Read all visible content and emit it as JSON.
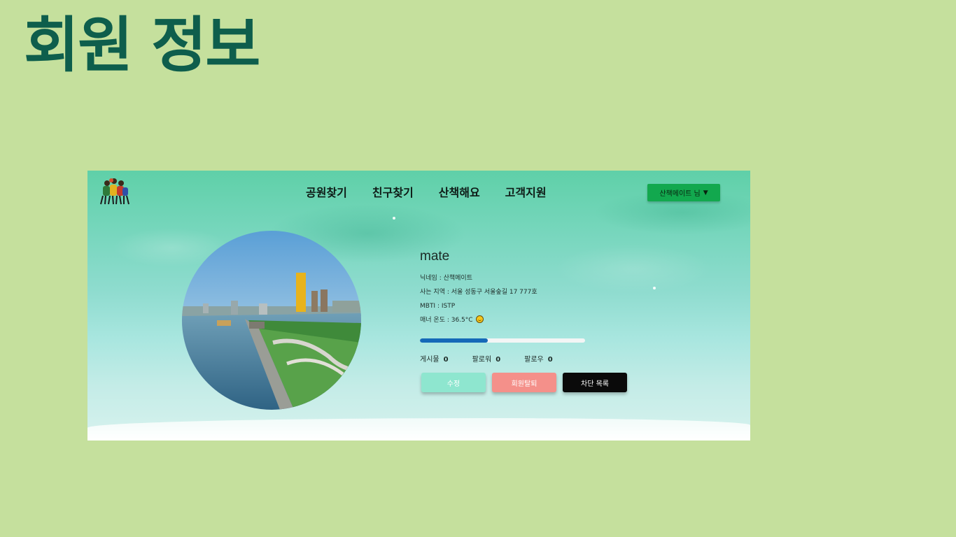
{
  "slide": {
    "title": "회원 정보"
  },
  "nav": {
    "menu": [
      "공원찾기",
      "친구찾기",
      "산책해요",
      "고객지원"
    ],
    "user_menu_label": "산책메이트 님"
  },
  "profile": {
    "username": "mate",
    "nickname_line": "닉네임 : 산책메이트",
    "region_line": "사는 지역 : 서울 성동구 서울숲길 17 777호",
    "mbti_line": "MBTI : ISTP",
    "manner_line": "매너 온도 : 36.5°C",
    "manner_progress": 0.41
  },
  "stats": [
    {
      "label": "게시물",
      "value": "0"
    },
    {
      "label": "팔로워",
      "value": "0"
    },
    {
      "label": "팔로우",
      "value": "0"
    }
  ],
  "buttons": {
    "edit": "수정",
    "withdraw": "회원탈퇴",
    "block_list": "차단 목록"
  },
  "colors": {
    "slide_bg": "#c5e09d",
    "title": "#0e5e4c",
    "user_menu_bg": "#12a84e",
    "edit_button": "#8ee6cf",
    "withdraw_button": "#f4908a",
    "block_button": "#0a0a0a",
    "progress_fill": "#1569b8"
  },
  "icons": {
    "logo": "people-group-logo",
    "manner_emoji": "smile-icon",
    "user_menu_caret": "caret-down-icon"
  }
}
